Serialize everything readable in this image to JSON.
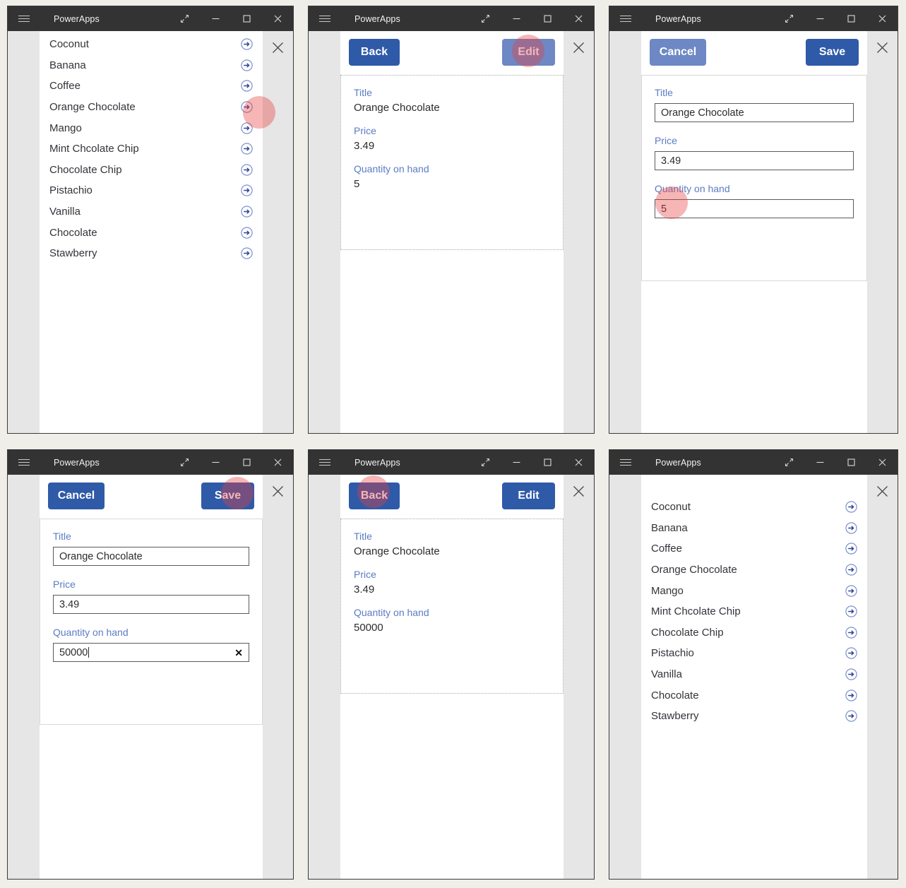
{
  "app": {
    "title": "PowerApps",
    "window_controls": [
      "restore-icon",
      "minimize-icon",
      "maximize-icon",
      "close-icon"
    ],
    "colors": {
      "titlebar": "#333333",
      "accent_button": "#2f5aa8",
      "accent_button_hover": "#6d88c4",
      "field_label": "#5b7cc4",
      "arrow_icon": "#3b5ca8",
      "click_highlight": "#e83e3e",
      "page_background": "#efeee8"
    }
  },
  "list_screen": {
    "items": [
      "Coconut",
      "Banana",
      "Coffee",
      "Orange Chocolate",
      "Mango",
      "Mint Chcolate Chip",
      "Chocolate Chip",
      "Pistachio",
      "Vanilla",
      "Chocolate",
      "Stawberry"
    ],
    "row_icon": "circle-arrow-right-icon"
  },
  "detail_screen": {
    "back_label": "Back",
    "edit_label": "Edit",
    "fields": [
      {
        "label": "Title",
        "value": "Orange Chocolate"
      },
      {
        "label": "Price",
        "value": "3.49"
      },
      {
        "label": "Quantity on hand",
        "value": "5"
      }
    ]
  },
  "detail_screen_updated": {
    "back_label": "Back",
    "edit_label": "Edit",
    "fields": [
      {
        "label": "Title",
        "value": "Orange Chocolate"
      },
      {
        "label": "Price",
        "value": "3.49"
      },
      {
        "label": "Quantity on hand",
        "value": "50000"
      }
    ]
  },
  "edit_screen": {
    "cancel_label": "Cancel",
    "save_label": "Save",
    "fields": [
      {
        "label": "Title",
        "value": "Orange Chocolate"
      },
      {
        "label": "Price",
        "value": "3.49"
      },
      {
        "label": "Quantity on hand",
        "value": "5"
      }
    ]
  },
  "edit_screen_typed": {
    "cancel_label": "Cancel",
    "save_label": "Save",
    "clear_icon": "clear-x-icon",
    "fields": [
      {
        "label": "Title",
        "value": "Orange Chocolate"
      },
      {
        "label": "Price",
        "value": "3.49"
      },
      {
        "label": "Quantity on hand",
        "value": "50000"
      }
    ]
  },
  "panels": [
    {
      "step": 1,
      "screen": "list",
      "click_target": "row-arrow-orange-chocolate"
    },
    {
      "step": 2,
      "screen": "detail",
      "click_target": "edit-button"
    },
    {
      "step": 3,
      "screen": "edit",
      "click_target": "quantity-on-hand-input"
    },
    {
      "step": 4,
      "screen": "edit-typed",
      "click_target": "save-button"
    },
    {
      "step": 5,
      "screen": "detail-updated",
      "click_target": "back-button"
    },
    {
      "step": 6,
      "screen": "list",
      "click_target": "none"
    }
  ]
}
